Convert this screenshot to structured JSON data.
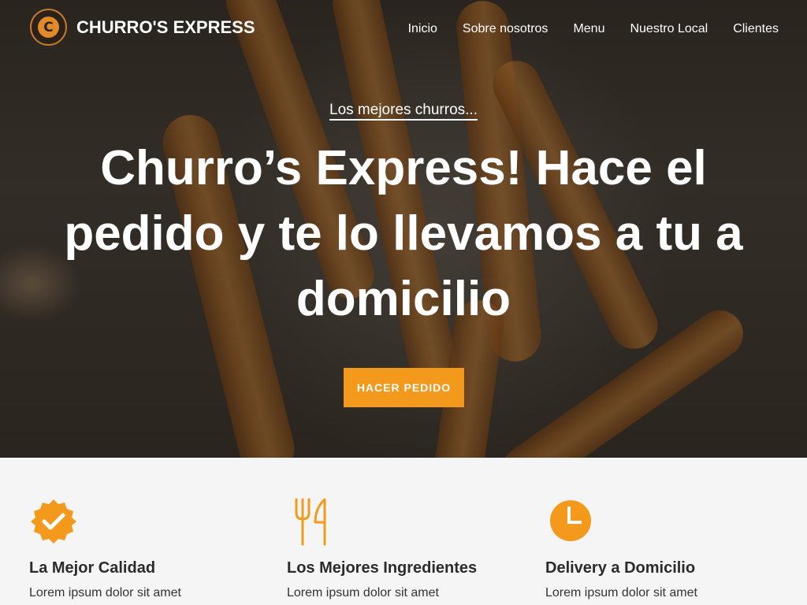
{
  "header": {
    "brand": "CHURRO'S EXPRESS",
    "logo_letter": "C",
    "nav": [
      "Inicio",
      "Sobre nosotros",
      "Menu",
      "Nuestro Local",
      "Clientes"
    ]
  },
  "hero": {
    "eyebrow": "Los mejores churros...",
    "headline": "Churro’s Express! Hace el pedido y te lo llevamos a tu a domicilio",
    "cta_label": "HACER PEDIDO"
  },
  "features": [
    {
      "icon": "check-badge-icon",
      "title": "La Mejor Calidad",
      "text": "Lorem ipsum dolor sit amet"
    },
    {
      "icon": "fork-knife-icon",
      "title": "Los Mejores Ingredientes",
      "text": "Lorem ipsum dolor sit amet"
    },
    {
      "icon": "clock-icon",
      "title": "Delivery a Domicilio",
      "text": "Lorem ipsum dolor sit amet"
    }
  ],
  "colors": {
    "accent": "#f39a1d",
    "text_dark": "#2b2b2b",
    "section_bg": "#f5f5f5"
  }
}
